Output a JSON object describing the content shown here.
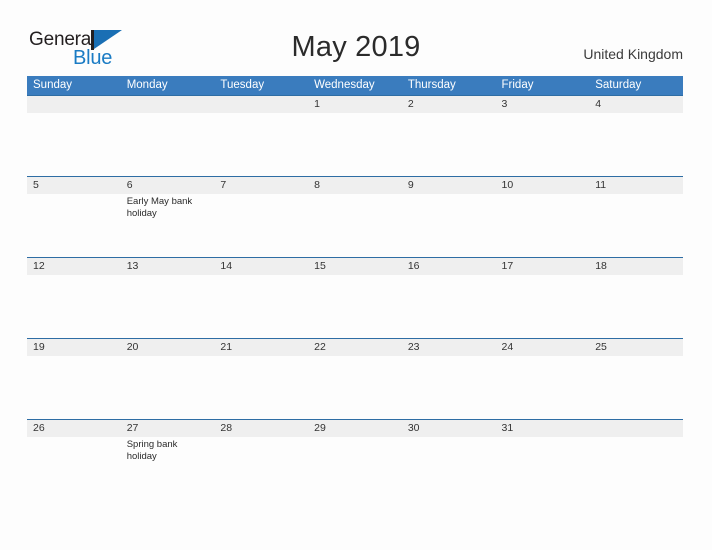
{
  "header": {
    "logo": {
      "word1": "General",
      "word2": "Blue",
      "flag_icon": "triangle-flag-icon",
      "brand_color": "#1a7bc4"
    },
    "title": "May 2019",
    "locale": "United Kingdom"
  },
  "calendar": {
    "accent_color": "#3a7cbe",
    "band_color": "#efefef",
    "weekdays": [
      "Sunday",
      "Monday",
      "Tuesday",
      "Wednesday",
      "Thursday",
      "Friday",
      "Saturday"
    ],
    "weeks": [
      {
        "days": [
          {
            "num": "",
            "event": ""
          },
          {
            "num": "",
            "event": ""
          },
          {
            "num": "",
            "event": ""
          },
          {
            "num": "1",
            "event": ""
          },
          {
            "num": "2",
            "event": ""
          },
          {
            "num": "3",
            "event": ""
          },
          {
            "num": "4",
            "event": ""
          }
        ]
      },
      {
        "days": [
          {
            "num": "5",
            "event": ""
          },
          {
            "num": "6",
            "event": "Early May bank holiday"
          },
          {
            "num": "7",
            "event": ""
          },
          {
            "num": "8",
            "event": ""
          },
          {
            "num": "9",
            "event": ""
          },
          {
            "num": "10",
            "event": ""
          },
          {
            "num": "11",
            "event": ""
          }
        ]
      },
      {
        "days": [
          {
            "num": "12",
            "event": ""
          },
          {
            "num": "13",
            "event": ""
          },
          {
            "num": "14",
            "event": ""
          },
          {
            "num": "15",
            "event": ""
          },
          {
            "num": "16",
            "event": ""
          },
          {
            "num": "17",
            "event": ""
          },
          {
            "num": "18",
            "event": ""
          }
        ]
      },
      {
        "days": [
          {
            "num": "19",
            "event": ""
          },
          {
            "num": "20",
            "event": ""
          },
          {
            "num": "21",
            "event": ""
          },
          {
            "num": "22",
            "event": ""
          },
          {
            "num": "23",
            "event": ""
          },
          {
            "num": "24",
            "event": ""
          },
          {
            "num": "25",
            "event": ""
          }
        ]
      },
      {
        "days": [
          {
            "num": "26",
            "event": ""
          },
          {
            "num": "27",
            "event": "Spring bank holiday"
          },
          {
            "num": "28",
            "event": ""
          },
          {
            "num": "29",
            "event": ""
          },
          {
            "num": "30",
            "event": ""
          },
          {
            "num": "31",
            "event": ""
          },
          {
            "num": "",
            "event": ""
          }
        ]
      }
    ]
  }
}
